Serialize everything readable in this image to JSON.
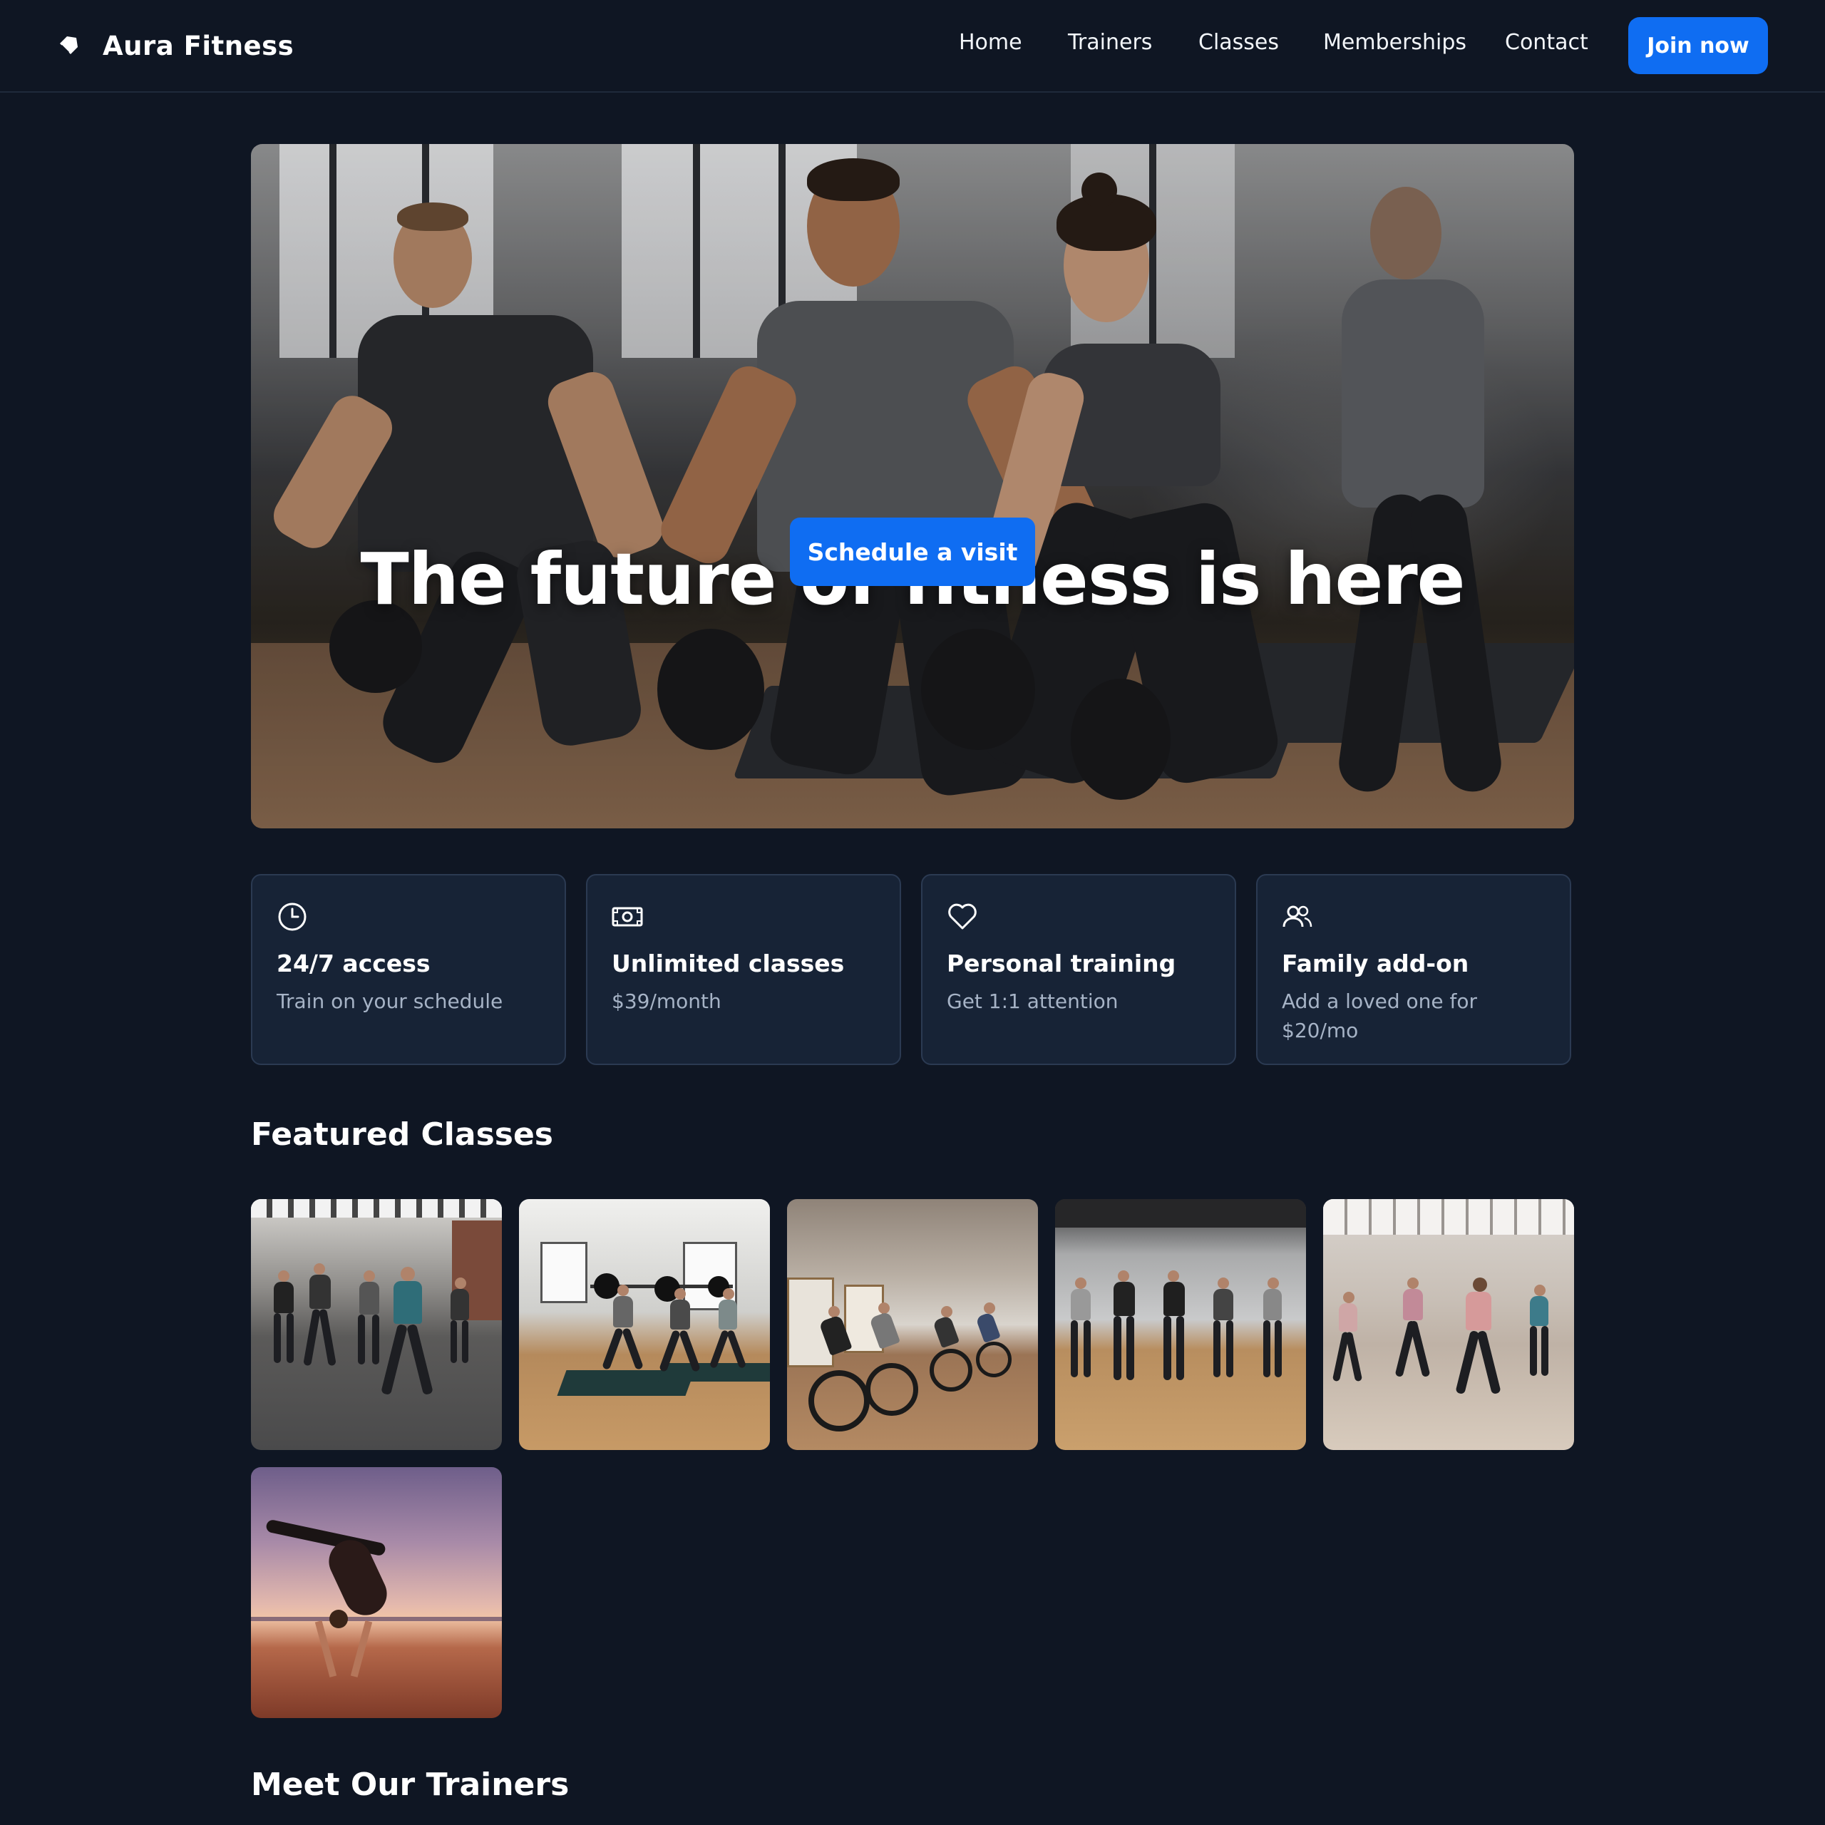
{
  "brand": {
    "name": "Aura Fitness",
    "logo_icon": "tag-icon"
  },
  "nav": {
    "items": [
      {
        "label": "Home"
      },
      {
        "label": "Trainers"
      },
      {
        "label": "Classes"
      },
      {
        "label": "Memberships"
      },
      {
        "label": "Contact"
      }
    ],
    "cta_label": "Join now"
  },
  "hero": {
    "title": "The future of fitness is here",
    "cta_label": "Schedule a visit"
  },
  "features": [
    {
      "icon": "clock-icon",
      "title": "24/7 access",
      "description": "Train on your schedule"
    },
    {
      "icon": "cash-icon",
      "title": "Unlimited classes",
      "description": "$39/month"
    },
    {
      "icon": "heart-icon",
      "title": "Personal training",
      "description": "Get 1:1 attention"
    },
    {
      "icon": "users-icon",
      "title": "Family add-on",
      "description": "Add a loved one for $20/mo"
    }
  ],
  "featured_classes": {
    "title": "Featured Classes",
    "cards": [
      {
        "image": "group-workout-photo"
      },
      {
        "image": "barbell-class-photo"
      },
      {
        "image": "spin-class-photo"
      },
      {
        "image": "group-exercise-photo"
      },
      {
        "image": "dance-class-photo"
      },
      {
        "image": "yoga-beach-photo"
      }
    ]
  },
  "trainers": {
    "title": "Meet Our Trainers"
  },
  "colors": {
    "background": "#0f1623",
    "accent": "#0f6df2",
    "card": "#172336",
    "card_border": "#2b3a52",
    "muted_text": "#a6b3c6"
  }
}
